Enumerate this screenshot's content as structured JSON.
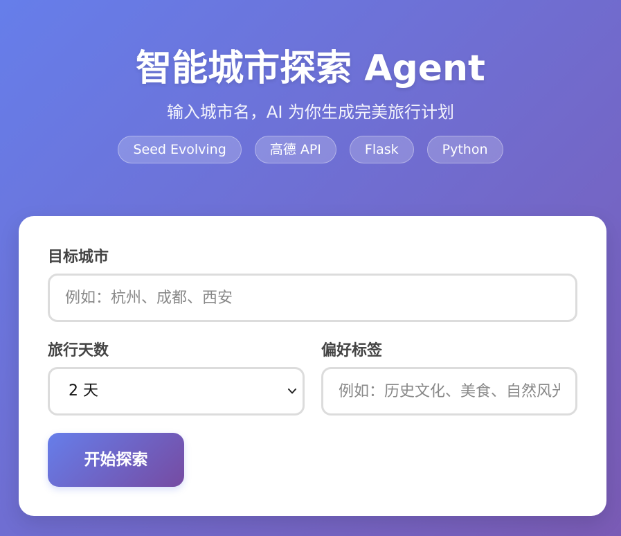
{
  "header": {
    "title": "智能城市探索 Agent",
    "subtitle": "输入城市名，AI 为你生成完美旅行计划",
    "tags": [
      "Seed Evolving",
      "高德 API",
      "Flask",
      "Python"
    ]
  },
  "form": {
    "city": {
      "label": "目标城市",
      "placeholder": "例如：杭州、成都、西安",
      "value": ""
    },
    "days": {
      "label": "旅行天数",
      "selected": "2 天"
    },
    "preferences": {
      "label": "偏好标签",
      "placeholder": "例如：历史文化、美食、自然风光",
      "value": ""
    },
    "submit_label": "开始探索"
  },
  "colors": {
    "gradient_start": "#667eea",
    "gradient_end": "#764ba2",
    "card_bg": "#ffffff",
    "border": "#dcdcdc"
  },
  "icons": {
    "select_arrow": "chevron-down-icon"
  }
}
